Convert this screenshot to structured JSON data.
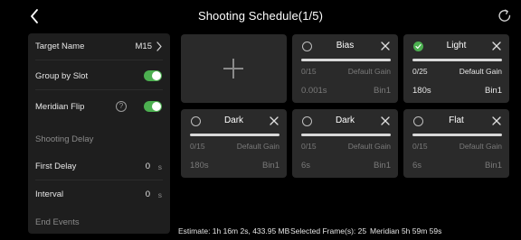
{
  "header": {
    "title": "Shooting Schedule(1/5)"
  },
  "settings": {
    "target_name_label": "Target Name",
    "target_name_value": "M15",
    "group_by_slot_label": "Group by Slot",
    "group_by_slot_on": true,
    "meridian_flip_label": "Meridian Flip",
    "meridian_flip_on": true,
    "shooting_delay_label": "Shooting Delay",
    "first_delay_label": "First Delay",
    "first_delay_value": "0",
    "first_delay_unit": "s",
    "interval_label": "Interval",
    "interval_value": "0",
    "interval_unit": "s",
    "end_events_label": "End Events"
  },
  "frames": [
    {
      "type": "Bias",
      "checked": false,
      "count": "0/15",
      "gain": "Default Gain",
      "exposure": "0.001s",
      "bin": "Bin1"
    },
    {
      "type": "Light",
      "checked": true,
      "count": "0/25",
      "gain": "Default Gain",
      "exposure": "180s",
      "bin": "Bin1"
    },
    {
      "type": "Dark",
      "checked": false,
      "count": "0/15",
      "gain": "Default Gain",
      "exposure": "180s",
      "bin": "Bin1"
    },
    {
      "type": "Dark",
      "checked": false,
      "count": "0/15",
      "gain": "Default Gain",
      "exposure": "6s",
      "bin": "Bin1"
    },
    {
      "type": "Flat",
      "checked": false,
      "count": "0/15",
      "gain": "Default Gain",
      "exposure": "6s",
      "bin": "Bin1"
    }
  ],
  "footer": {
    "estimate": "Estimate: 1h 16m 2s, 433.95 MB",
    "selected": "Selected Frame(s): 25",
    "meridian": "Meridian 5h 59m 59s"
  },
  "colors": {
    "accent_green": "#4caf50",
    "panel": "#1e1e1e",
    "card": "#2a2a2a"
  },
  "icons": [
    "back-arrow-icon",
    "refresh-icon",
    "chevron-right-icon",
    "help-circle-icon",
    "plus-icon",
    "check-icon",
    "close-icon"
  ]
}
